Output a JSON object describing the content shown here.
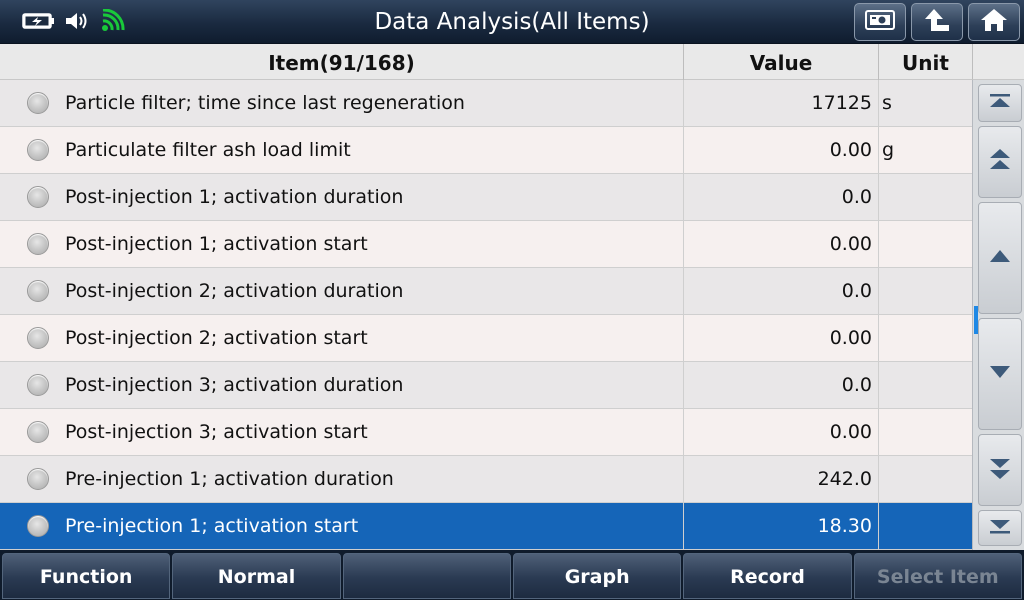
{
  "window": {
    "title": "Data Analysis(All Items)"
  },
  "status": {
    "icons": [
      "battery-charging-icon",
      "speaker-icon",
      "wifi-icon"
    ],
    "wifi_color": "#19c93a"
  },
  "top_buttons": [
    {
      "icon": "screenshot-icon"
    },
    {
      "icon": "back-arrow-icon"
    },
    {
      "icon": "home-icon"
    }
  ],
  "table": {
    "headers": {
      "item": "Item(91/168)",
      "value": "Value",
      "unit": "Unit"
    },
    "rows": [
      {
        "item": "Particle filter; time since last regeneration",
        "value": "17125",
        "unit": "s",
        "selected": false
      },
      {
        "item": "Particulate filter ash load limit",
        "value": "0.00",
        "unit": "g",
        "selected": false
      },
      {
        "item": "Post-injection 1; activation duration",
        "value": "0.0",
        "unit": "",
        "selected": false
      },
      {
        "item": "Post-injection 1; activation start",
        "value": "0.00",
        "unit": "",
        "selected": false
      },
      {
        "item": "Post-injection 2; activation duration",
        "value": "0.0",
        "unit": "",
        "selected": false
      },
      {
        "item": "Post-injection 2; activation start",
        "value": "0.00",
        "unit": "",
        "selected": false
      },
      {
        "item": "Post-injection 3; activation duration",
        "value": "0.0",
        "unit": "",
        "selected": false
      },
      {
        "item": "Post-injection 3; activation start",
        "value": "0.00",
        "unit": "",
        "selected": false
      },
      {
        "item": "Pre-injection 1; activation duration",
        "value": "242.0",
        "unit": "",
        "selected": false
      },
      {
        "item": "Pre-injection 1; activation start",
        "value": "18.30",
        "unit": "",
        "selected": true
      }
    ],
    "selected_color": "#1565b8"
  },
  "scrollbar": {
    "buttons": [
      "scroll-top-icon",
      "page-up-icon",
      "line-up-icon",
      "line-down-icon",
      "page-down-icon",
      "scroll-bottom-icon"
    ]
  },
  "bottom_bar": {
    "buttons": [
      {
        "label": "Function",
        "enabled": true
      },
      {
        "label": "Normal",
        "enabled": true
      },
      {
        "label": "",
        "enabled": true
      },
      {
        "label": "Graph",
        "enabled": true
      },
      {
        "label": "Record",
        "enabled": true
      },
      {
        "label": "Select Item",
        "enabled": false
      }
    ]
  }
}
